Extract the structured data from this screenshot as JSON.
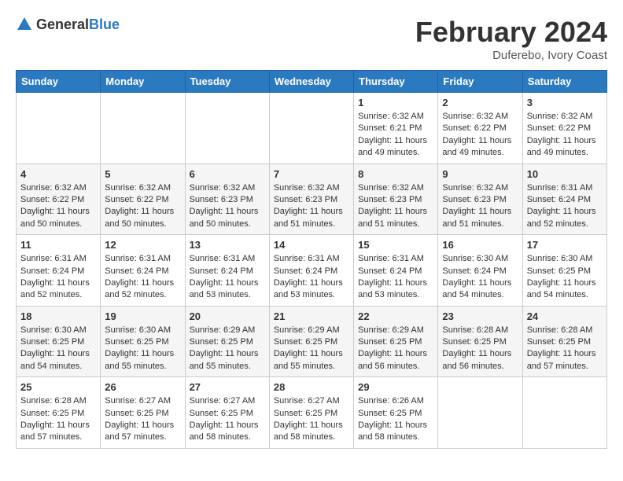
{
  "header": {
    "logo_general": "General",
    "logo_blue": "Blue",
    "main_title": "February 2024",
    "subtitle": "Duferebo, Ivory Coast"
  },
  "calendar": {
    "days_of_week": [
      "Sunday",
      "Monday",
      "Tuesday",
      "Wednesday",
      "Thursday",
      "Friday",
      "Saturday"
    ],
    "weeks": [
      [
        {
          "day": "",
          "info": ""
        },
        {
          "day": "",
          "info": ""
        },
        {
          "day": "",
          "info": ""
        },
        {
          "day": "",
          "info": ""
        },
        {
          "day": "1",
          "info": "Sunrise: 6:32 AM\nSunset: 6:21 PM\nDaylight: 11 hours and 49 minutes."
        },
        {
          "day": "2",
          "info": "Sunrise: 6:32 AM\nSunset: 6:22 PM\nDaylight: 11 hours and 49 minutes."
        },
        {
          "day": "3",
          "info": "Sunrise: 6:32 AM\nSunset: 6:22 PM\nDaylight: 11 hours and 49 minutes."
        }
      ],
      [
        {
          "day": "4",
          "info": "Sunrise: 6:32 AM\nSunset: 6:22 PM\nDaylight: 11 hours and 50 minutes."
        },
        {
          "day": "5",
          "info": "Sunrise: 6:32 AM\nSunset: 6:22 PM\nDaylight: 11 hours and 50 minutes."
        },
        {
          "day": "6",
          "info": "Sunrise: 6:32 AM\nSunset: 6:23 PM\nDaylight: 11 hours and 50 minutes."
        },
        {
          "day": "7",
          "info": "Sunrise: 6:32 AM\nSunset: 6:23 PM\nDaylight: 11 hours and 51 minutes."
        },
        {
          "day": "8",
          "info": "Sunrise: 6:32 AM\nSunset: 6:23 PM\nDaylight: 11 hours and 51 minutes."
        },
        {
          "day": "9",
          "info": "Sunrise: 6:32 AM\nSunset: 6:23 PM\nDaylight: 11 hours and 51 minutes."
        },
        {
          "day": "10",
          "info": "Sunrise: 6:31 AM\nSunset: 6:24 PM\nDaylight: 11 hours and 52 minutes."
        }
      ],
      [
        {
          "day": "11",
          "info": "Sunrise: 6:31 AM\nSunset: 6:24 PM\nDaylight: 11 hours and 52 minutes."
        },
        {
          "day": "12",
          "info": "Sunrise: 6:31 AM\nSunset: 6:24 PM\nDaylight: 11 hours and 52 minutes."
        },
        {
          "day": "13",
          "info": "Sunrise: 6:31 AM\nSunset: 6:24 PM\nDaylight: 11 hours and 53 minutes."
        },
        {
          "day": "14",
          "info": "Sunrise: 6:31 AM\nSunset: 6:24 PM\nDaylight: 11 hours and 53 minutes."
        },
        {
          "day": "15",
          "info": "Sunrise: 6:31 AM\nSunset: 6:24 PM\nDaylight: 11 hours and 53 minutes."
        },
        {
          "day": "16",
          "info": "Sunrise: 6:30 AM\nSunset: 6:24 PM\nDaylight: 11 hours and 54 minutes."
        },
        {
          "day": "17",
          "info": "Sunrise: 6:30 AM\nSunset: 6:25 PM\nDaylight: 11 hours and 54 minutes."
        }
      ],
      [
        {
          "day": "18",
          "info": "Sunrise: 6:30 AM\nSunset: 6:25 PM\nDaylight: 11 hours and 54 minutes."
        },
        {
          "day": "19",
          "info": "Sunrise: 6:30 AM\nSunset: 6:25 PM\nDaylight: 11 hours and 55 minutes."
        },
        {
          "day": "20",
          "info": "Sunrise: 6:29 AM\nSunset: 6:25 PM\nDaylight: 11 hours and 55 minutes."
        },
        {
          "day": "21",
          "info": "Sunrise: 6:29 AM\nSunset: 6:25 PM\nDaylight: 11 hours and 55 minutes."
        },
        {
          "day": "22",
          "info": "Sunrise: 6:29 AM\nSunset: 6:25 PM\nDaylight: 11 hours and 56 minutes."
        },
        {
          "day": "23",
          "info": "Sunrise: 6:28 AM\nSunset: 6:25 PM\nDaylight: 11 hours and 56 minutes."
        },
        {
          "day": "24",
          "info": "Sunrise: 6:28 AM\nSunset: 6:25 PM\nDaylight: 11 hours and 57 minutes."
        }
      ],
      [
        {
          "day": "25",
          "info": "Sunrise: 6:28 AM\nSunset: 6:25 PM\nDaylight: 11 hours and 57 minutes."
        },
        {
          "day": "26",
          "info": "Sunrise: 6:27 AM\nSunset: 6:25 PM\nDaylight: 11 hours and 57 minutes."
        },
        {
          "day": "27",
          "info": "Sunrise: 6:27 AM\nSunset: 6:25 PM\nDaylight: 11 hours and 58 minutes."
        },
        {
          "day": "28",
          "info": "Sunrise: 6:27 AM\nSunset: 6:25 PM\nDaylight: 11 hours and 58 minutes."
        },
        {
          "day": "29",
          "info": "Sunrise: 6:26 AM\nSunset: 6:25 PM\nDaylight: 11 hours and 58 minutes."
        },
        {
          "day": "",
          "info": ""
        },
        {
          "day": "",
          "info": ""
        }
      ]
    ]
  }
}
